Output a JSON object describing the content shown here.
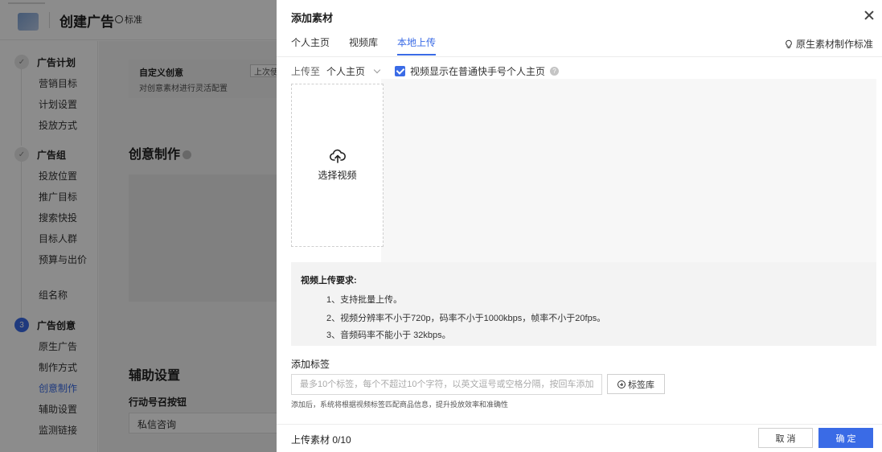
{
  "page": {
    "title": "创建广告",
    "badge": "标准"
  },
  "sidebar": {
    "steps": [
      {
        "label": "广告计划",
        "marker": "✓",
        "items": [
          "营销目标",
          "计划设置",
          "投放方式"
        ]
      },
      {
        "label": "广告组",
        "marker": "✓",
        "items": [
          "投放位置",
          "推广目标",
          "搜索快投",
          "目标人群",
          "预算与出价",
          "组名称"
        ]
      },
      {
        "label": "广告创意",
        "marker": "3",
        "items": [
          "原生广告",
          "制作方式",
          "创意制作",
          "辅助设置",
          "监测链接"
        ],
        "active_item": "创意制作"
      }
    ]
  },
  "main": {
    "custom_creative_title": "自定义创意",
    "custom_creative_desc": "对创意素材进行灵活配置",
    "last_used_btn": "上次使",
    "creative_section": "创意制作",
    "assist_section": "辅助设置",
    "call_button_label": "行动号召按钮",
    "call_button_value": "私信咨询"
  },
  "drawer": {
    "title": "添加素材",
    "tabs": [
      "个人主页",
      "视频库",
      "本地上传"
    ],
    "active_tab": "本地上传",
    "guide_link": "原生素材制作标准",
    "upload_to_label": "上传至",
    "upload_to_value": "个人主页",
    "show_on_profile_label": "视频显示在普通快手号个人主页",
    "show_on_profile_checked": true,
    "upload_box_label": "选择视频",
    "requirements": {
      "title": "视频上传要求:",
      "lines": [
        "1、支持批量上传。",
        "2、视频分辨率不小于720p，码率不小于1000kbps，帧率不小于20fps。",
        "3、音频码率不能小于 32kbps。"
      ]
    },
    "tags": {
      "label": "添加标签",
      "placeholder": "最多10个标签，每个不超过10个字符，以英文逗号或空格分隔，按回车添加",
      "library_button": "标签库",
      "hint": "添加后，系统将根据视频标签匹配商品信息，提升投放效率和准确性"
    },
    "footer": {
      "upload_count": "上传素材 0/10",
      "cancel": "取 消",
      "confirm": "确 定"
    }
  },
  "colors": {
    "accent": "#3a6be6",
    "overlay": "rgba(0,0,0,0.45)"
  }
}
